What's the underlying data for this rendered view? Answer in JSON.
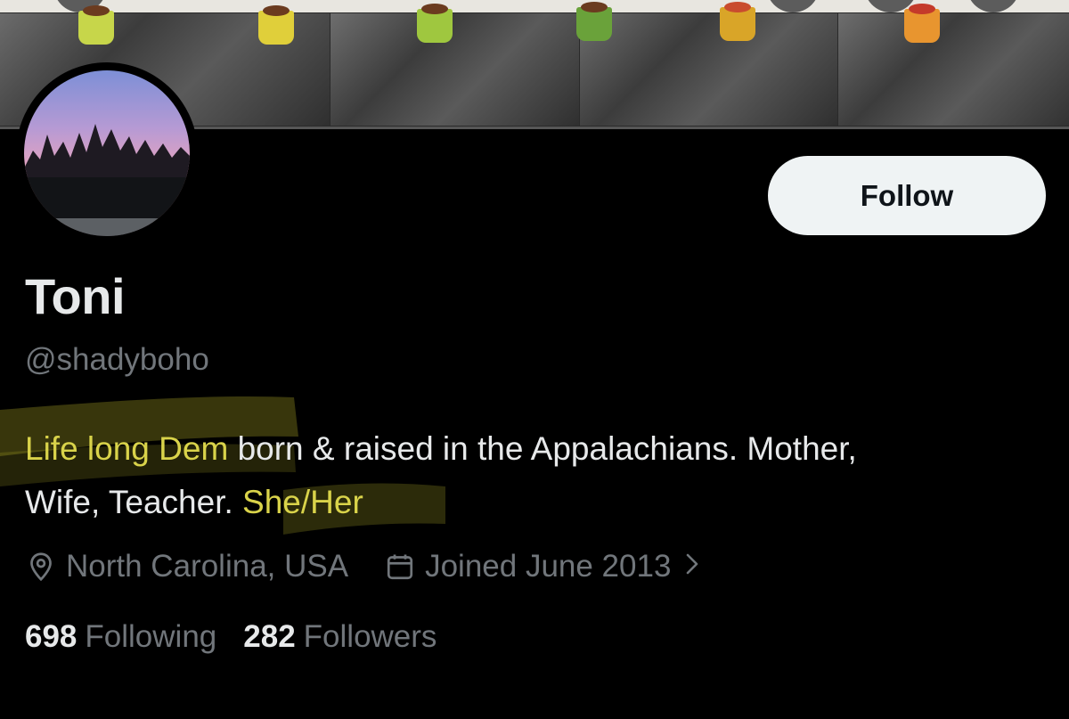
{
  "profile": {
    "name": "Toni",
    "handle": "@shadyboho",
    "bio": {
      "line1_highlighted": "Life long Dem ",
      "line1_rest": "born & raised in the Appalachians. Mother,",
      "line2_plain": "Wife, Teacher. ",
      "line2_highlighted": "She/Her"
    },
    "location": "North Carolina, USA",
    "joined": "Joined June 2013",
    "following_count": "698",
    "following_label": "Following",
    "followers_count": "282",
    "followers_label": "Followers"
  },
  "actions": {
    "follow_label": "Follow"
  },
  "icons": {
    "location": "location-pin-icon",
    "calendar": "calendar-icon",
    "chevron": "chevron-right-icon"
  },
  "colors": {
    "background": "#000000",
    "text_primary": "#e7e9ea",
    "text_secondary": "#71767b",
    "highlight": "#d9d34a",
    "button_bg": "#eff3f4"
  }
}
